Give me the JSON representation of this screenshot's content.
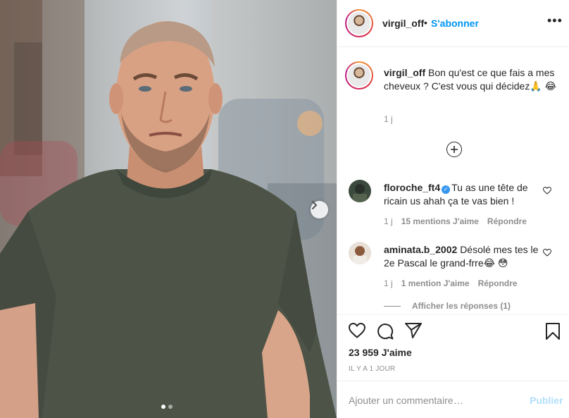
{
  "post": {
    "image_alt": "",
    "carousel": {
      "total": 2,
      "current": 1
    }
  },
  "header": {
    "username": "virgil_off",
    "separator": "•",
    "follow_label": "S'abonner",
    "more_icon": "more-icon"
  },
  "caption": {
    "username": "virgil_off",
    "text": "Bon qu'est ce que fais a mes cheveux ? C'est vous qui décidez🙏 😂",
    "time": "1 j"
  },
  "load_more_icon": "plus-circle-icon",
  "comments": [
    {
      "username": "floroche_ft4",
      "verified": true,
      "text": "Tu as une tête de ricain us ahah ça te vas bien !",
      "time": "1 j",
      "likes": "15 mentions J'aime",
      "reply_label": "Répondre"
    },
    {
      "username": "aminata.b_2002",
      "verified": false,
      "text": "Désolé mes tes le 2e Pascal le grand-frre😂 😳",
      "time": "1 j",
      "likes": "1 mention J'aime",
      "reply_label": "Répondre"
    }
  ],
  "view_replies": "Afficher les réponses (1)",
  "likes_count": "23 959 J'aime",
  "post_date": "IL Y A 1 JOUR",
  "add_comment": {
    "placeholder": "Ajouter un commentaire…",
    "publish_label": "Publier"
  },
  "colors": {
    "link_blue": "#0095f6",
    "publish_disabled": "#b2dffc",
    "muted": "#8e8e8e",
    "text": "#262626"
  }
}
